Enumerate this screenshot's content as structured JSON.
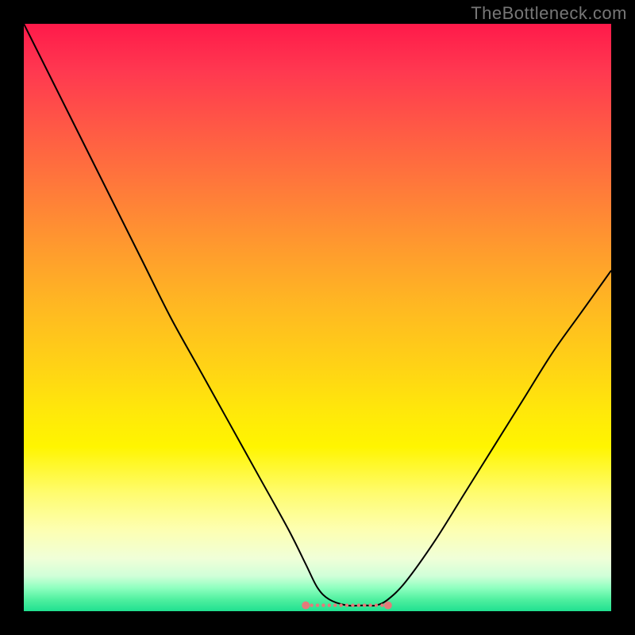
{
  "watermark": "TheBottleneck.com",
  "chart_data": {
    "type": "line",
    "title": "",
    "xlabel": "",
    "ylabel": "",
    "xlim": [
      0,
      100
    ],
    "ylim": [
      0,
      100
    ],
    "x": [
      0,
      5,
      10,
      15,
      20,
      25,
      30,
      35,
      40,
      45,
      48,
      50,
      52,
      55,
      58,
      60,
      62,
      65,
      70,
      75,
      80,
      85,
      90,
      95,
      100
    ],
    "y": [
      100,
      90,
      80,
      70,
      60,
      50,
      41,
      32,
      23,
      14,
      8,
      4,
      2,
      1,
      1,
      1,
      2,
      5,
      12,
      20,
      28,
      36,
      44,
      51,
      58
    ],
    "valley_marker": {
      "x_start": 48,
      "x_end": 62,
      "y": 1
    }
  }
}
